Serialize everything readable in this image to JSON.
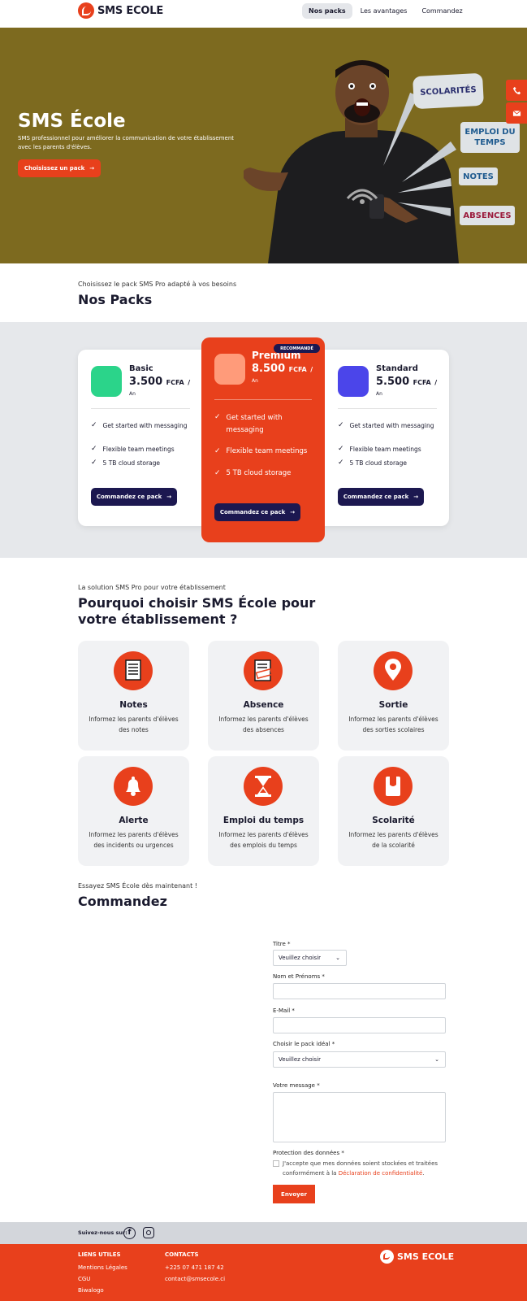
{
  "header": {
    "brand": "SMS ECOLE",
    "nav": [
      {
        "label": "Nos packs",
        "active": true
      },
      {
        "label": "Les avantages",
        "active": false
      },
      {
        "label": "Commandez",
        "active": false
      }
    ]
  },
  "hero": {
    "title": "SMS École",
    "subtitle": "SMS professionnel pour améliorer la communication de votre établissement avec les parents d'élèves.",
    "cta": "Choisissez un pack",
    "bubbles": [
      "SCOLARITÉS",
      "EMPLOI DU TEMPS",
      "NOTES",
      "ABSENCES"
    ],
    "side_icons": [
      "phone-icon",
      "mail-icon"
    ]
  },
  "packs": {
    "pretitle": "Choisissez le pack SMS Pro adapté à vos besoins",
    "title": "Nos Packs",
    "badge": "RECOMMANDÉ",
    "items": [
      {
        "name": "Basic",
        "price": "3.500",
        "currency": "FCFA",
        "slash": "/",
        "period": "An",
        "features": [
          "Get started with messaging",
          "Flexible team meetings",
          "5 TB cloud storage"
        ],
        "button": "Commandez ce pack",
        "color": "#2bd48a"
      },
      {
        "name": "Premium",
        "price": "8.500",
        "currency": "FCFA",
        "slash": "/",
        "period": "An",
        "features": [
          "Get started with messaging",
          "Flexible team meetings",
          "5 TB cloud storage"
        ],
        "button": "Commandez ce pack",
        "color": "#ff9b7a"
      },
      {
        "name": "Standard",
        "price": "5.500",
        "currency": "FCFA",
        "slash": "/",
        "period": "An",
        "features": [
          "Get started with messaging",
          "Flexible team meetings",
          "5 TB cloud storage"
        ],
        "button": "Commandez ce pack",
        "color": "#4b45ea"
      }
    ]
  },
  "why": {
    "pretitle": "La solution SMS Pro pour votre établissement",
    "title": "Pourquoi choisir SMS École pour votre établissement ?",
    "features": [
      {
        "name": "Notes",
        "desc": "Informez les parents d'élèves des notes",
        "icon": "document-icon"
      },
      {
        "name": "Absence",
        "desc": "Informez les parents d'élèves des absences",
        "icon": "absent-stamp-icon"
      },
      {
        "name": "Sortie",
        "desc": "Informez les parents d'élèves des sorties scolaires",
        "icon": "map-pin-icon"
      },
      {
        "name": "Alerte",
        "desc": "Informez les parents d'élèves des incidents ou urgences",
        "icon": "bell-icon"
      },
      {
        "name": "Emploi du temps",
        "desc": "Informez les parents d'élèves des emplois du temps",
        "icon": "hourglass-icon"
      },
      {
        "name": "Scolarité",
        "desc": "Informez les parents d'élèves de la scolarité",
        "icon": "wallet-icon"
      }
    ]
  },
  "order": {
    "pretitle": "Essayez SMS École dès maintenant !",
    "title": "Commandez",
    "fields": {
      "title_label": "Titre *",
      "title_value": "Veuillez choisir",
      "name_label": "Nom et Prénoms *",
      "email_label": "E-Mail *",
      "pack_label": "Choisir le pack idéal *",
      "pack_value": "Veuillez choisir",
      "message_label": "Votre message *",
      "privacy_label": "Protection des données *",
      "consent_text": "J'accepte que mes données soient stockées et traitées conformément à la",
      "consent_link": "Déclaration de confidentialité",
      "consent_end": "."
    },
    "submit": "Envoyer"
  },
  "footer": {
    "follow": "Suivez-nous sur:",
    "social": [
      "facebook-icon",
      "instagram-icon"
    ],
    "links_title": "LIENS UTILES",
    "links": [
      "Mentions Légales",
      "CGU",
      "Biwalogo"
    ],
    "contacts_title": "CONTACTS",
    "contacts": [
      "+225 07 471 187 42",
      "contact@smsecole.ci"
    ],
    "brand": "SMS ECOLE"
  }
}
